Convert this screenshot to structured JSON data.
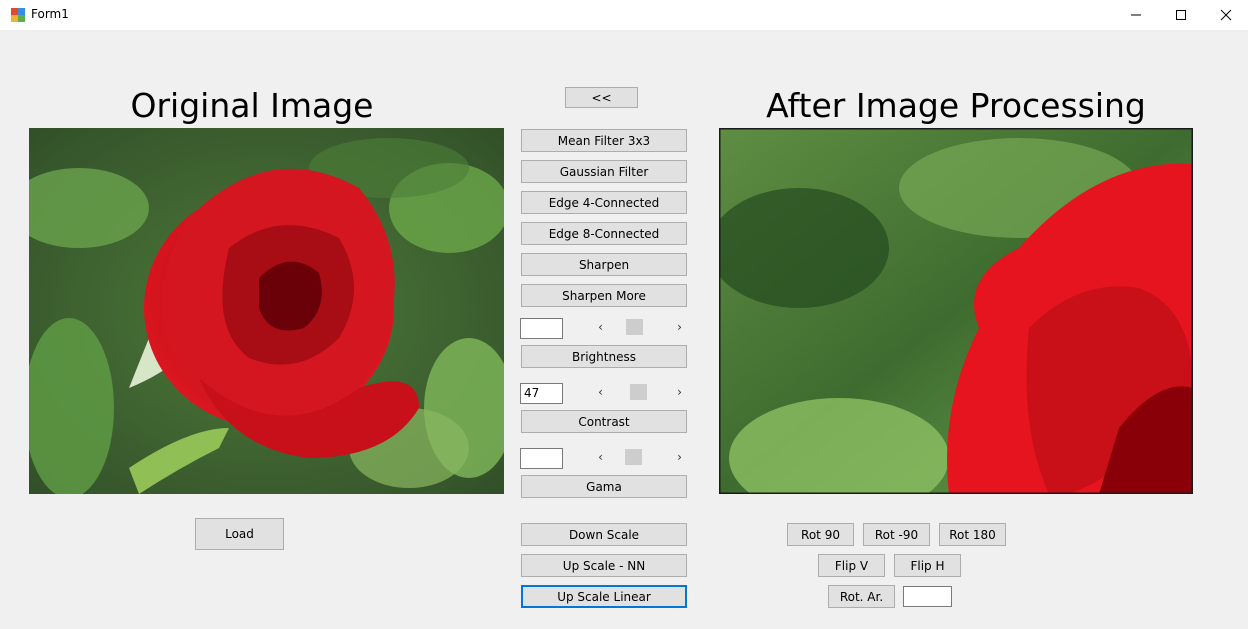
{
  "window": {
    "title": "Form1",
    "minimize": "—",
    "maximize": "☐",
    "close": "✕"
  },
  "headings": {
    "original": "Original Image",
    "processed": "After Image Processing"
  },
  "filters": {
    "back": "<<",
    "mean": "Mean Filter 3x3",
    "gaussian": "Gaussian Filter",
    "edge4": "Edge 4-Connected",
    "edge8": "Edge 8-Connected",
    "sharpen": "Sharpen",
    "sharpen_more": "Sharpen More"
  },
  "brightness": {
    "value": "",
    "label": "Brightness",
    "level": 0.38
  },
  "contrast": {
    "value": "47",
    "label": "Contrast",
    "level": 0.47
  },
  "gamma": {
    "value": "",
    "label": "Gama",
    "level": 0.36
  },
  "scale": {
    "down": "Down Scale",
    "up_nn": "Up Scale - NN",
    "up_linear": "Up Scale Linear"
  },
  "load": "Load",
  "transform": {
    "rot90": "Rot 90",
    "rot_neg90": "Rot -90",
    "rot180": "Rot 180",
    "flipv": "Flip V",
    "fliph": "Flip H",
    "rot_ar": "Rot. Ar.",
    "angle_value": ""
  },
  "scroll_arrows": {
    "left": "‹",
    "right": "›"
  },
  "colors": {
    "accent": "#0078d7",
    "rose": "#d0101a",
    "leaf": "#5a9a3c"
  }
}
